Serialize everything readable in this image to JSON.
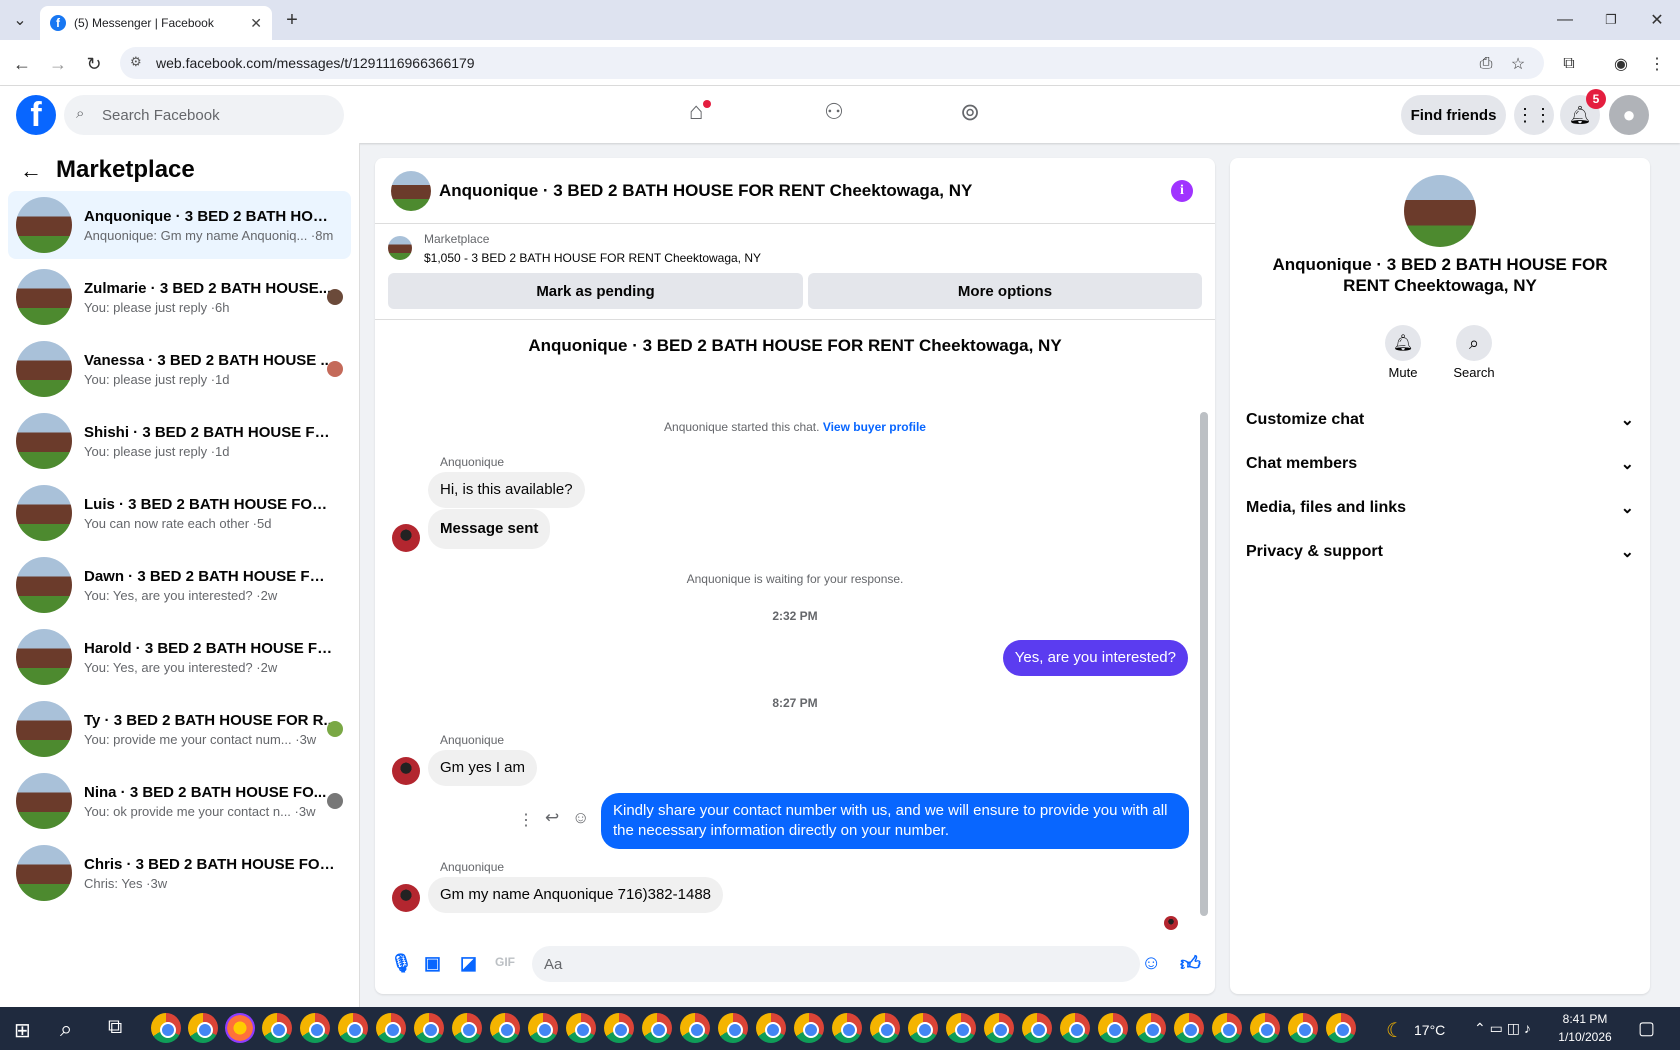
{
  "browser": {
    "tab_title": "(5) Messenger | Facebook",
    "url": "web.facebook.com/messages/t/1291116966366179"
  },
  "header": {
    "search_placeholder": "Search Facebook",
    "find_friends": "Find friends",
    "notifications_count": "5"
  },
  "sidebar": {
    "title": "Marketplace",
    "conversations": [
      {
        "name": "Anquonique · 3 BED 2 BATH HOUS...",
        "preview": "Anquonique: Gm my name Anquoniq... ·8m",
        "active": true
      },
      {
        "name": "Zulmarie · 3 BED 2 BATH HOUSE...",
        "preview": "You: please just reply ·6h"
      },
      {
        "name": "Vanessa · 3 BED 2 BATH HOUSE ...",
        "preview": "You: please just reply ·1d"
      },
      {
        "name": "Shishi · 3 BED 2 BATH HOUSE FOR ...",
        "preview": "You: please just reply ·1d"
      },
      {
        "name": "Luis · 3 BED 2 BATH HOUSE FOR R...",
        "preview": "You can now rate each other ·5d"
      },
      {
        "name": "Dawn · 3 BED 2 BATH HOUSE FOR ...",
        "preview": "You: Yes, are you interested? ·2w"
      },
      {
        "name": "Harold · 3 BED 2 BATH HOUSE FO...",
        "preview": "You: Yes, are you interested? ·2w"
      },
      {
        "name": "Ty · 3 BED 2 BATH HOUSE FOR R...",
        "preview": "You: provide me your contact num... ·3w"
      },
      {
        "name": "Nina · 3 BED 2 BATH HOUSE FO...",
        "preview": "You: ok provide me your contact n... ·3w"
      },
      {
        "name": "Chris · 3 BED 2 BATH HOUSE FOR ...",
        "preview": "Chris: Yes ·3w"
      }
    ]
  },
  "chat": {
    "title": "Anquonique · 3 BED 2 BATH HOUSE FOR RENT Cheektowaga, NY",
    "marketplace_label": "Marketplace",
    "listing": "$1,050 - 3 BED 2 BATH HOUSE FOR RENT Cheektowaga, NY",
    "mark_pending": "Mark as pending",
    "more_options": "More options",
    "intro_title": "Anquonique · 3 BED 2 BATH HOUSE FOR RENT Cheektowaga, NY",
    "started": "Anquonique started this chat.",
    "view_buyer_profile": "View buyer profile",
    "sender": "Anquonique",
    "msg1": "Hi, is this available?",
    "msg2": "Message sent",
    "waiting": "Anquonique is waiting for your response.",
    "time1": "2:32 PM",
    "out1": "Yes, are you interested?",
    "time2": "8:27 PM",
    "msg3": "Gm yes I am",
    "out2": "Kindly share your contact number with us, and we will ensure to provide you with all the necessary information directly on your number.",
    "msg4": "Gm my name Anquonique 716)382-1488",
    "composer_placeholder": "Aa"
  },
  "right_panel": {
    "title": "Anquonique · 3 BED 2 BATH HOUSE FOR RENT Cheektowaga, NY",
    "mute": "Mute",
    "search": "Search",
    "sections": [
      "Customize chat",
      "Chat members",
      "Media, files and links",
      "Privacy & support"
    ]
  },
  "taskbar": {
    "temperature": "17°C",
    "time": "8:41 PM",
    "date": "1/10/2026"
  },
  "colors": {
    "brand": "#0866ff",
    "accent_purple": "#5b3cf0"
  }
}
